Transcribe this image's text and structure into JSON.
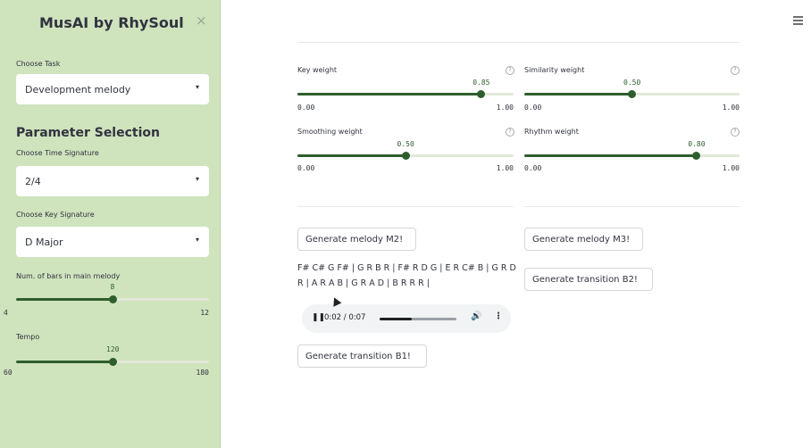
{
  "sidebar": {
    "title": "MusAI by RhySoul",
    "close_icon": "×",
    "task": {
      "label": "Choose Task",
      "value": "Development melody"
    },
    "section_header": "Parameter Selection",
    "time_signature": {
      "label": "Choose Time Signature",
      "value": "2/4"
    },
    "key_signature": {
      "label": "Choose Key Signature",
      "value": "D Major"
    },
    "bars": {
      "label": "Num. of bars in main melody",
      "value": "8",
      "min": "4",
      "max": "12",
      "fraction": 0.5
    },
    "tempo": {
      "label": "Tempo",
      "value": "120",
      "min": "60",
      "max": "180",
      "fraction": 0.5
    }
  },
  "weights": {
    "key": {
      "label": "Key weight",
      "value": "0.85",
      "min": "0.00",
      "max": "1.00",
      "fraction": 0.85
    },
    "similarity": {
      "label": "Similarity weight",
      "value": "0.50",
      "min": "0.00",
      "max": "1.00",
      "fraction": 0.5
    },
    "smoothing": {
      "label": "Smoothing weight",
      "value": "0.50",
      "min": "0.00",
      "max": "1.00",
      "fraction": 0.5
    },
    "rhythm": {
      "label": "Rhythm weight",
      "value": "0.80",
      "min": "0.00",
      "max": "1.00",
      "fraction": 0.8
    },
    "help_glyph": "?"
  },
  "buttons": {
    "m2": "Generate melody M2!",
    "m3": "Generate melody M3!",
    "b2": "Generate transition B2!",
    "b1": "Generate transition B1!"
  },
  "melody_notes": "F# C# G F# | G R B R | F# R D G | E R C# B | G R D R | A R A B | G R A D | B R R R |",
  "audio": {
    "play_glyph": "❚❚",
    "time": "0:02 / 0:07",
    "progress": 0.42,
    "volume_glyph": "🔊",
    "more_glyph": "⋮"
  },
  "icons": {
    "menu": "hamburger-menu-icon",
    "help": "question-circle-icon",
    "caret": "▾"
  },
  "colors": {
    "sidebar_bg": "#cfe3bd",
    "accent": "#2e5e2c"
  }
}
